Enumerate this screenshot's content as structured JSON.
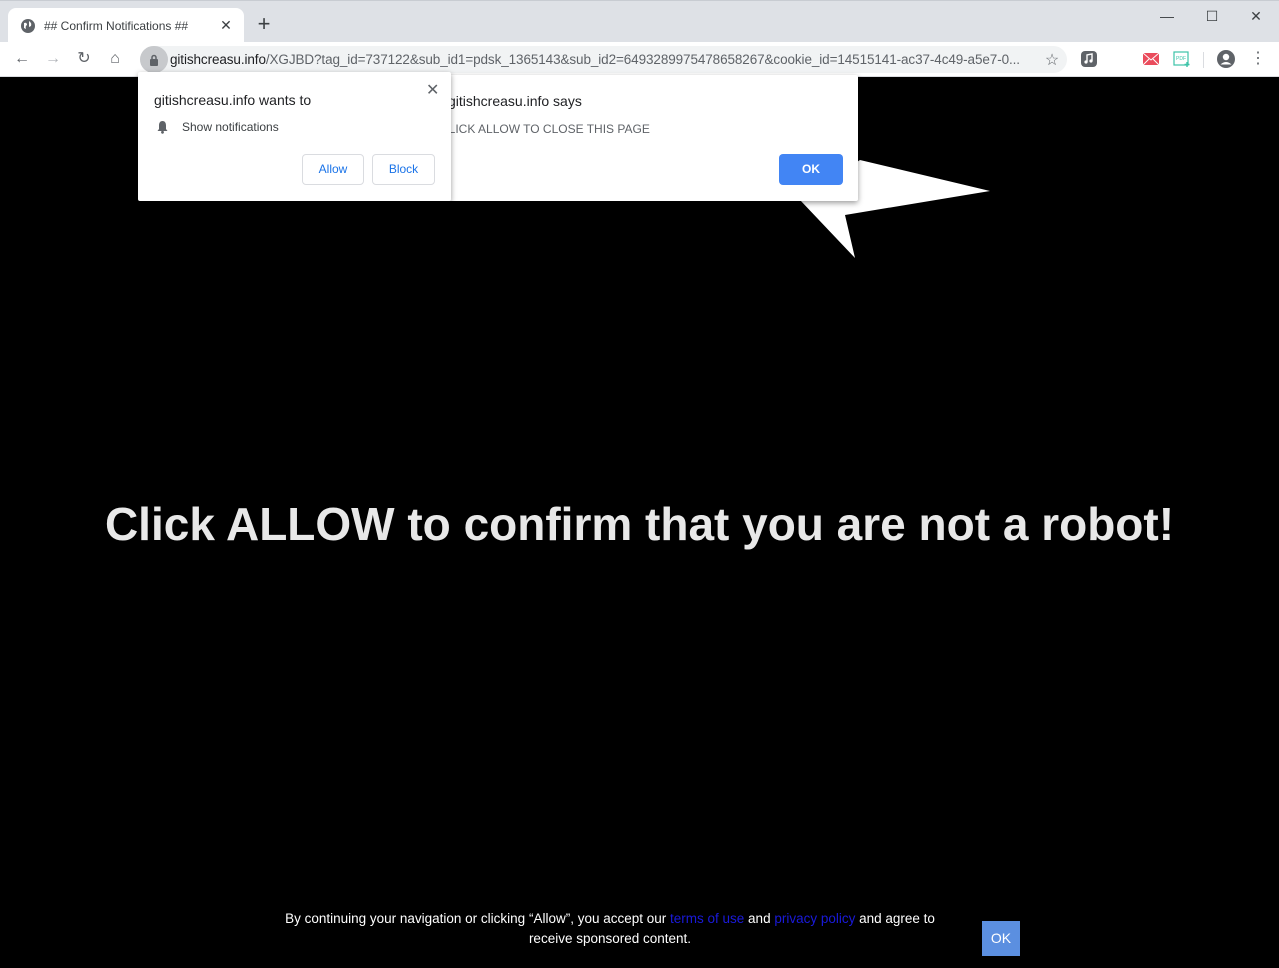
{
  "browser": {
    "tab": {
      "title": "## Confirm Notifications ##",
      "icon": "globe-icon"
    },
    "new_tab_label": "+",
    "window_controls": {
      "minimize": "—",
      "maximize": "☐",
      "close": "✕"
    },
    "address_bar": {
      "host": "gitishcreasu.info",
      "path": "/XGJBD?tag_id=737122&sub_id1=pdsk_1365143&sub_id2=6493289975478658267&cookie_id=14515141-ac37-4c49-a5e7-0..."
    },
    "nav": {
      "back": "←",
      "forward": "→",
      "reload": "↻",
      "home": "⌂"
    },
    "star": "☆",
    "menu": "⋮",
    "extensions": [
      "music-extension-icon",
      "mail-extension-icon",
      "pdf-extension-icon"
    ]
  },
  "permission_prompt": {
    "title": "gitishcreasu.info wants to",
    "permission": "Show notifications",
    "allow_label": "Allow",
    "block_label": "Block",
    "close": "✕"
  },
  "alert_dialog": {
    "title": "gitishcreasu.info says",
    "message": "CLICK ALLOW TO CLOSE THIS PAGE",
    "ok_label": "OK"
  },
  "page": {
    "headline": "Click ALLOW to confirm that you are not a robot!",
    "footer": {
      "text_before": "By continuing your navigation or clicking “Allow”, you accept our ",
      "terms_link": "terms of use",
      "text_mid": " and ",
      "privacy_link": "privacy policy",
      "text_after": " and agree to receive sponsored content.",
      "ok_label": "OK"
    }
  },
  "colors": {
    "accent": "#4285f4",
    "footer_ok": "#5b8fe0",
    "link": "#1a1adb"
  }
}
